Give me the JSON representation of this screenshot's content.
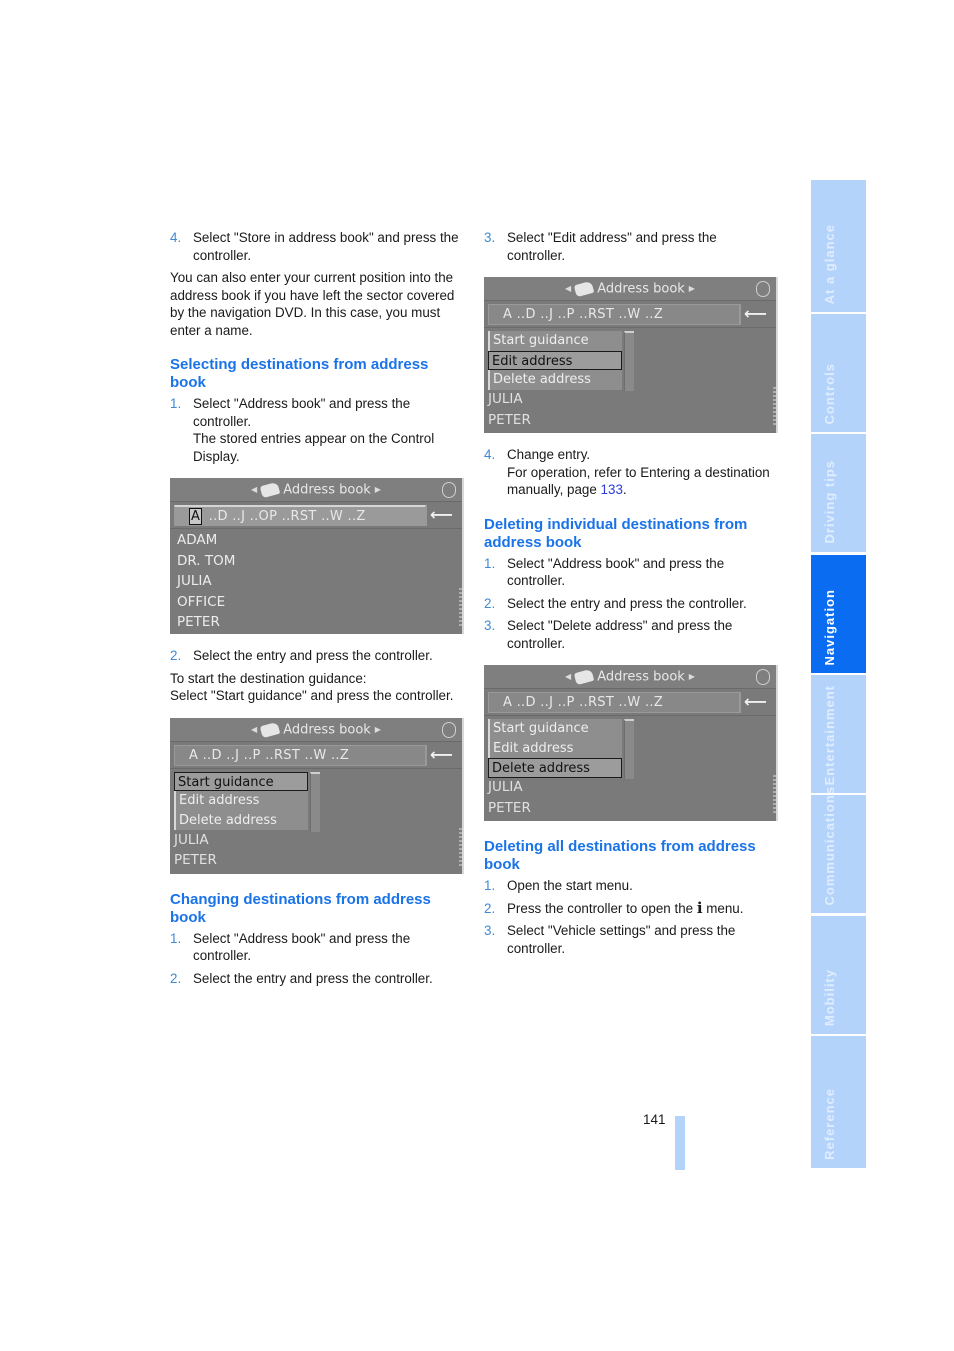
{
  "left_column": {
    "intro_step": {
      "num": "4.",
      "text": "Select \"Store in address book\" and press the controller."
    },
    "intro_para": "You can also enter your current position into the address book if you have left the sector covered by the navigation DVD. In this case, you must enter a name.",
    "section1": {
      "heading": "Selecting destinations from address book",
      "step1": {
        "num": "1.",
        "text": "Select \"Address book\" and press the controller.",
        "note": "The stored entries appear on the Control Display."
      },
      "screen": {
        "title": "Address book",
        "alpha_selected": "A",
        "alpha_rest": "..D ..J ..OP ..RST ..W ..Z",
        "back_icon": "⟵",
        "entries": [
          "ADAM",
          "DR. TOM",
          "JULIA",
          "OFFICE",
          "PETER"
        ]
      },
      "step2": {
        "num": "2.",
        "text": "Select the entry and press the controller."
      },
      "para1": "To start the destination guidance:",
      "para2": "Select \"Start guidance\" and press the controller.",
      "screen2": {
        "title": "Address book",
        "alpha": "A ..D ..J ..P ..RST ..W ..Z",
        "back_icon": "⟵",
        "options": [
          "Start guidance",
          "Edit address",
          "Delete address"
        ],
        "selected_option": "Start guidance",
        "entries": [
          "JULIA",
          "PETER"
        ]
      }
    },
    "section2": {
      "heading": "Changing destinations from address book",
      "step1": {
        "num": "1.",
        "text": "Select \"Address book\" and press the controller."
      },
      "step2": {
        "num": "2.",
        "text": "Select the entry and press the controller."
      }
    }
  },
  "right_column": {
    "step3": {
      "num": "3.",
      "text": "Select \"Edit address\" and press the controller."
    },
    "screen3": {
      "title": "Address book",
      "alpha": "A ..D ..J ..P ..RST ..W ..Z",
      "back_icon": "⟵",
      "options": [
        "Start guidance",
        "Edit address",
        "Delete address"
      ],
      "selected_option": "Edit address",
      "entries": [
        "JULIA",
        "PETER"
      ]
    },
    "step4": {
      "num": "4.",
      "text": "Change entry.",
      "note_prefix": "For operation, refer to Entering a destination manually, page ",
      "note_link": "133",
      "note_suffix": "."
    },
    "section3": {
      "heading": "Deleting individual destinations from address book",
      "step1": {
        "num": "1.",
        "text": "Select \"Address book\" and press the controller."
      },
      "step2": {
        "num": "2.",
        "text": "Select the entry and press the controller."
      },
      "step3": {
        "num": "3.",
        "text": "Select \"Delete address\" and press the controller."
      },
      "screen": {
        "title": "Address book",
        "alpha": "A ..D ..J ..P ..RST ..W ..Z",
        "back_icon": "⟵",
        "options": [
          "Start guidance",
          "Edit address",
          "Delete address"
        ],
        "selected_option": "Delete address",
        "entries": [
          "JULIA",
          "PETER"
        ]
      }
    },
    "section4": {
      "heading": "Deleting all destinations from address book",
      "step1": {
        "num": "1.",
        "text": "Open the start menu."
      },
      "step2": {
        "num": "2.",
        "text_prefix": "Press the controller to open the ",
        "icon": "i",
        "text_suffix": " menu."
      },
      "step3": {
        "num": "3.",
        "text": "Select \"Vehicle settings\" and press the controller."
      }
    }
  },
  "sidebar": {
    "active_color": "#0a6cf0",
    "inactive_color": "#b3d3fb",
    "tabs": [
      {
        "label": "At a glance",
        "active": false
      },
      {
        "label": "Controls",
        "active": false
      },
      {
        "label": "Driving tips",
        "active": false
      },
      {
        "label": "Navigation",
        "active": true
      },
      {
        "label": "Entertainment",
        "active": false
      },
      {
        "label": "Communications",
        "active": false
      },
      {
        "label": "Mobility",
        "active": false
      },
      {
        "label": "Reference",
        "active": false
      }
    ]
  },
  "footer": {
    "page_number": "141"
  }
}
